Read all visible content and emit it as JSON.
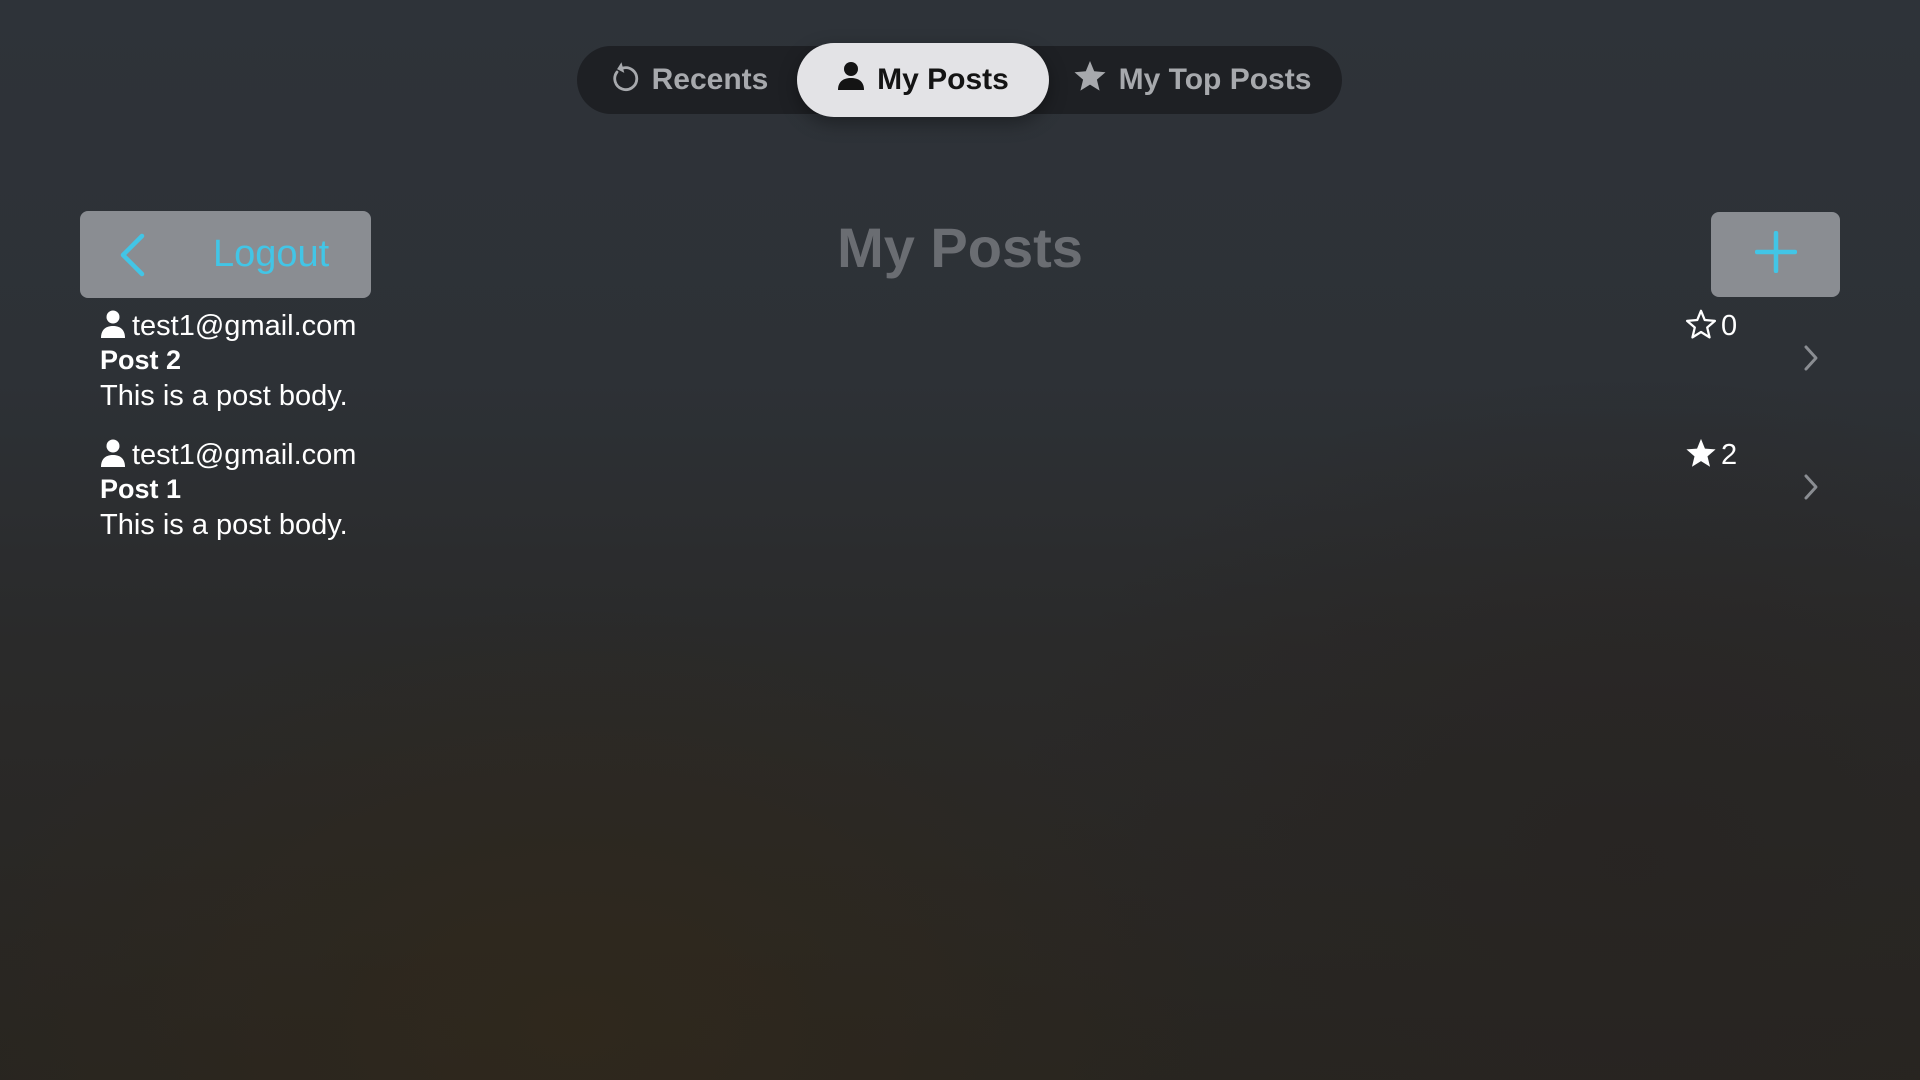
{
  "tabs": [
    {
      "label": "Recents",
      "icon": "recents-arrow-icon",
      "selected": false
    },
    {
      "label": "My Posts",
      "icon": "person-icon",
      "selected": true
    },
    {
      "label": "My Top Posts",
      "icon": "star-filled-icon",
      "selected": false
    }
  ],
  "header": {
    "back_label": "Logout",
    "title": "My Posts",
    "add_icon": "plus-icon"
  },
  "posts": [
    {
      "author": "test1@gmail.com",
      "title": "Post 2",
      "body": "This is a post body.",
      "stars": "0",
      "starred": false
    },
    {
      "author": "test1@gmail.com",
      "title": "Post 1",
      "body": "This is a post body.",
      "stars": "2",
      "starred": true
    }
  ],
  "colors": {
    "accent": "#42c5e6",
    "button_bg": "#8a8d92",
    "tab_bar_bg": "#1e2024",
    "selected_tab_bg": "#e3e3e6",
    "title_gray": "#6a6d72"
  }
}
